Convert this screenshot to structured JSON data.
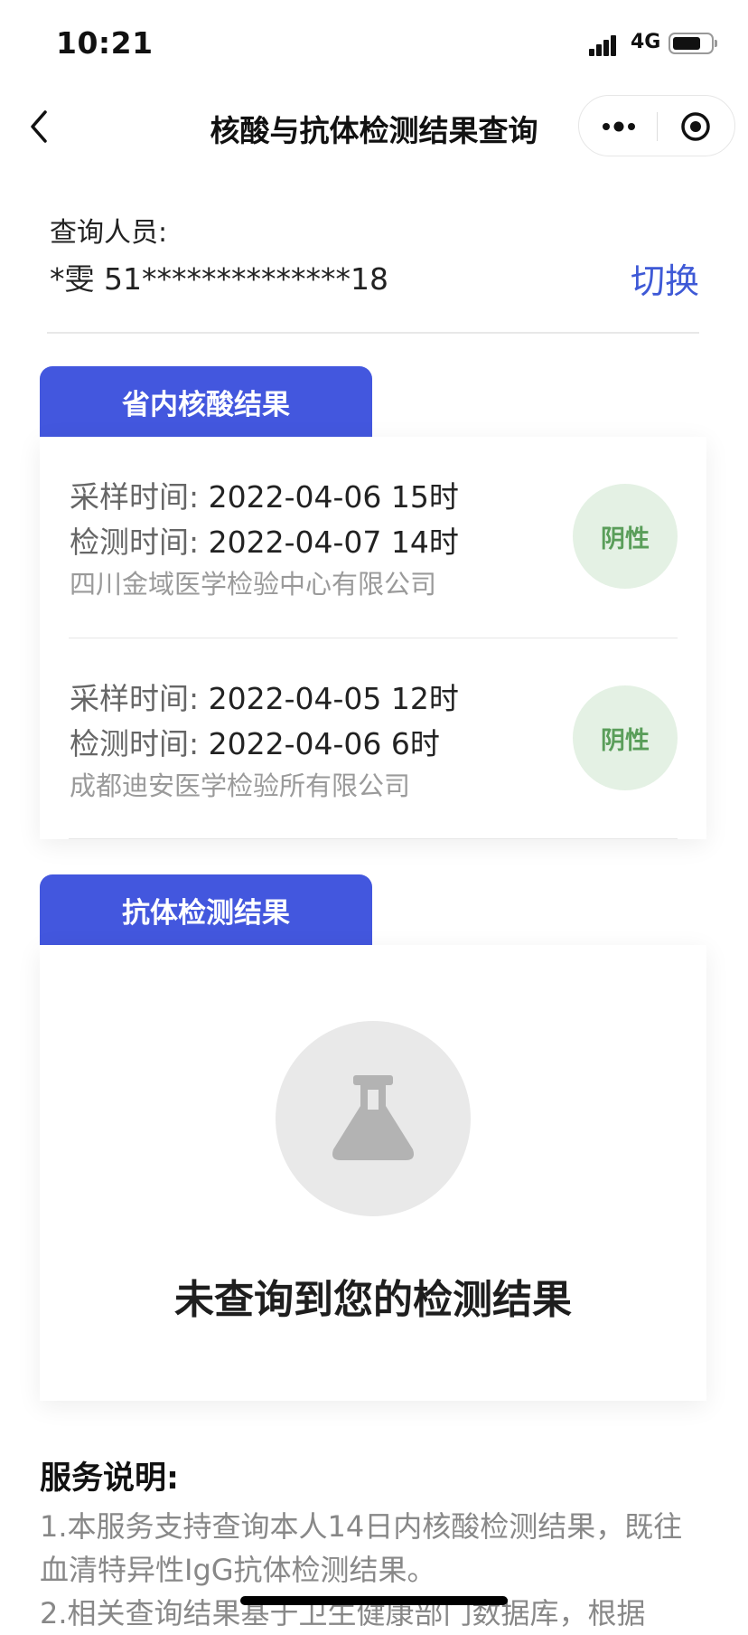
{
  "status_bar": {
    "time": "10:21",
    "network": "4G",
    "icons": [
      "signal-icon",
      "battery-icon"
    ]
  },
  "nav": {
    "title": "核酸与抗体检测结果查询",
    "icons": [
      "back-icon",
      "more-icon",
      "target-icon"
    ]
  },
  "person": {
    "label": "查询人员:",
    "value": "*雯 51**************18",
    "switch_label": "切换"
  },
  "nucleic": {
    "tab_label": "省内核酸结果",
    "results": [
      {
        "sample_label": "采样时间:",
        "sample_time": "2022-04-06 15时",
        "test_label": "检测时间:",
        "test_time": "2022-04-07 14时",
        "org": "四川金域医学检验中心有限公司",
        "result": "阴性"
      },
      {
        "sample_label": "采样时间:",
        "sample_time": "2022-04-05 12时",
        "test_label": "检测时间:",
        "test_time": "2022-04-06 6时",
        "org": "成都迪安医学检验所有限公司",
        "result": "阴性"
      }
    ]
  },
  "antibody": {
    "tab_label": "抗体检测结果",
    "empty_text": "未查询到您的检测结果",
    "empty_icon": "flask-icon"
  },
  "service": {
    "title": "服务说明:",
    "note1_line1": "1.本服务支持查询本人14日内核酸检测结果，既往",
    "note1_line2": "血清特异性IgG抗体检测结果。",
    "note2_line1": "2.相关查询结果基于卫生健康部门数据库，根据"
  },
  "colors": {
    "accent": "#4357de",
    "switch_text": "#3e59d6",
    "negative_badge_bg": "#e4f1e4",
    "negative_badge_text": "#5a9e5a"
  }
}
